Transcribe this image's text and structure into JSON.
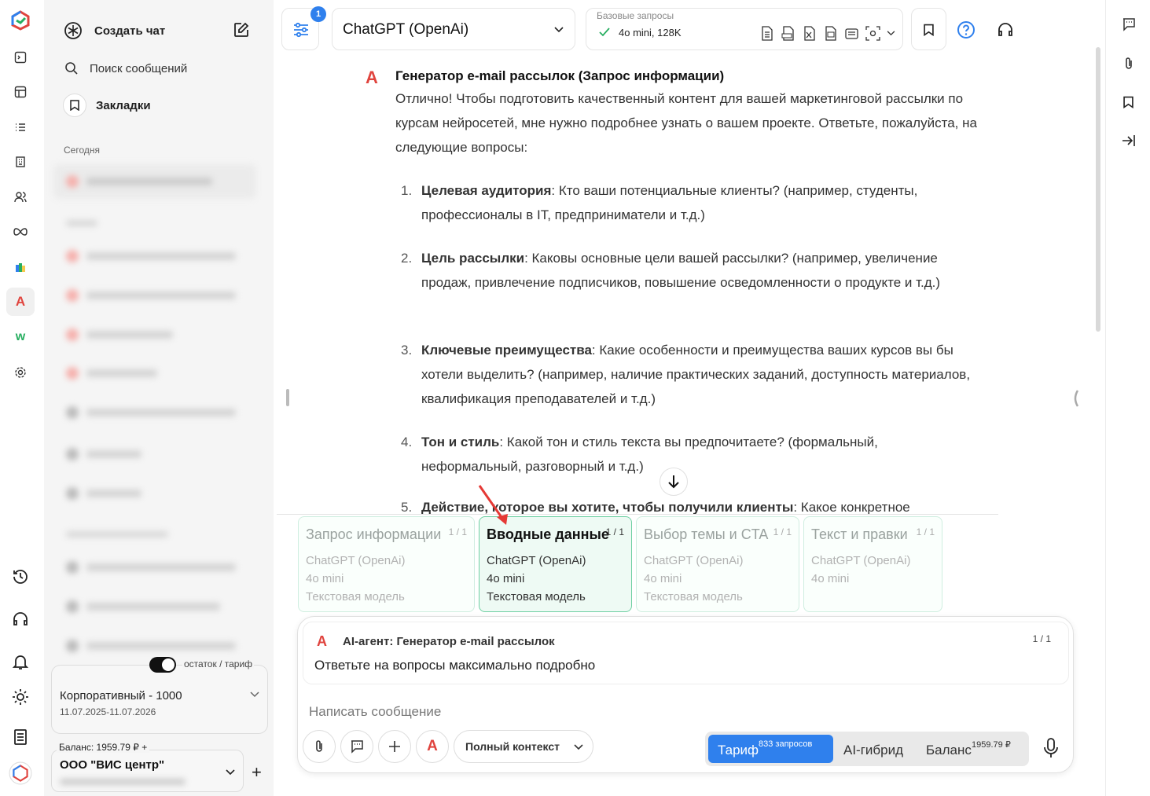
{
  "sidebar": {
    "new_chat_label": "Создать чат",
    "search_label": "Поиск сообщений",
    "bookmarks_label": "Закладки",
    "section_today": "Сегодня",
    "toggle_label": "остаток / тариф",
    "plan_name": "Корпоративный - 1000",
    "plan_dates": "11.07.2025-11.07.2026",
    "balance_label": "Баланс: 1959.79 ₽ +",
    "org_name": "ООО \"ВИС центр\"",
    "add_label": "+"
  },
  "toolbar": {
    "filter_badge": "1",
    "model_name": "ChatGPT (OpenAi)",
    "base_requests_label": "Базовые запросы",
    "base_model": "4o mini, 128K"
  },
  "message": {
    "title": "Генератор e-mail рассылок (Запрос информации)",
    "intro": "Отлично! Чтобы подготовить качественный контент для вашей маркетинговой рассылки по курсам нейросетей, мне нужно подробнее узнать о вашем проекте. Ответьте, пожалуйста, на следующие вопросы:",
    "items": [
      {
        "num": "1.",
        "bold": "Целевая аудитория",
        "text": ": Кто ваши потенциальные клиенты? (например, студенты, профессионалы в IT, предприниматели и т.д.)"
      },
      {
        "num": "2.",
        "bold": "Цель рассылки",
        "text": ": Каковы основные цели вашей рассылки? (например, увеличение продаж, привлечение подписчиков, повышение осведомленности о продукте и т.д.)"
      },
      {
        "num": "3.",
        "bold": "Ключевые преимущества",
        "text": ": Какие особенности и преимущества ваших курсов вы бы хотели выделить? (например, наличие практических заданий, доступность материалов, квалификация преподавателей и т.д.)"
      },
      {
        "num": "4.",
        "bold": "Тон и стиль",
        "text": ": Какой тон и стиль текста вы предпочитаете? (формальный, неформальный, разговорный и т.д.)"
      },
      {
        "num": "5.",
        "bold": "Действие, которое вы хотите, чтобы получили клиенты",
        "text": ": Какое конкретное"
      }
    ]
  },
  "steps": [
    {
      "title": "Запрос информации",
      "count": "1 / 1",
      "model": "ChatGPT (OpenAi)",
      "variant": "4o mini",
      "type": "Текстовая модель"
    },
    {
      "title": "Вводные данные",
      "count": "1 / 1",
      "model": "ChatGPT (OpenAi)",
      "variant": "4o mini",
      "type": "Текстовая модель"
    },
    {
      "title": "Выбор темы и CTA",
      "count": "1 / 1",
      "model": "ChatGPT (OpenAi)",
      "variant": "4o mini",
      "type": "Текстовая модель"
    },
    {
      "title": "Текст и правки",
      "count": "1 / 1",
      "model": "ChatGPT (OpenAi)",
      "variant": "4o mini"
    }
  ],
  "agent": {
    "title": "AI-агент: Генератор e-mail рассылок",
    "count": "1 / 1",
    "instruction": "Ответьте на вопросы максимально подробно"
  },
  "composer": {
    "placeholder": "Написать сообщение",
    "context_label": "Полный контекст",
    "tariff_label": "Тариф",
    "tariff_sup": "833 запросов",
    "hybrid_label": "AI-гибрид",
    "balance_label": "Баланс",
    "balance_sup": "1959.79 ₽"
  },
  "colors": {
    "accent": "#2f80ed",
    "step_border": "#6fd0a3",
    "logo_red": "#e0443e"
  }
}
